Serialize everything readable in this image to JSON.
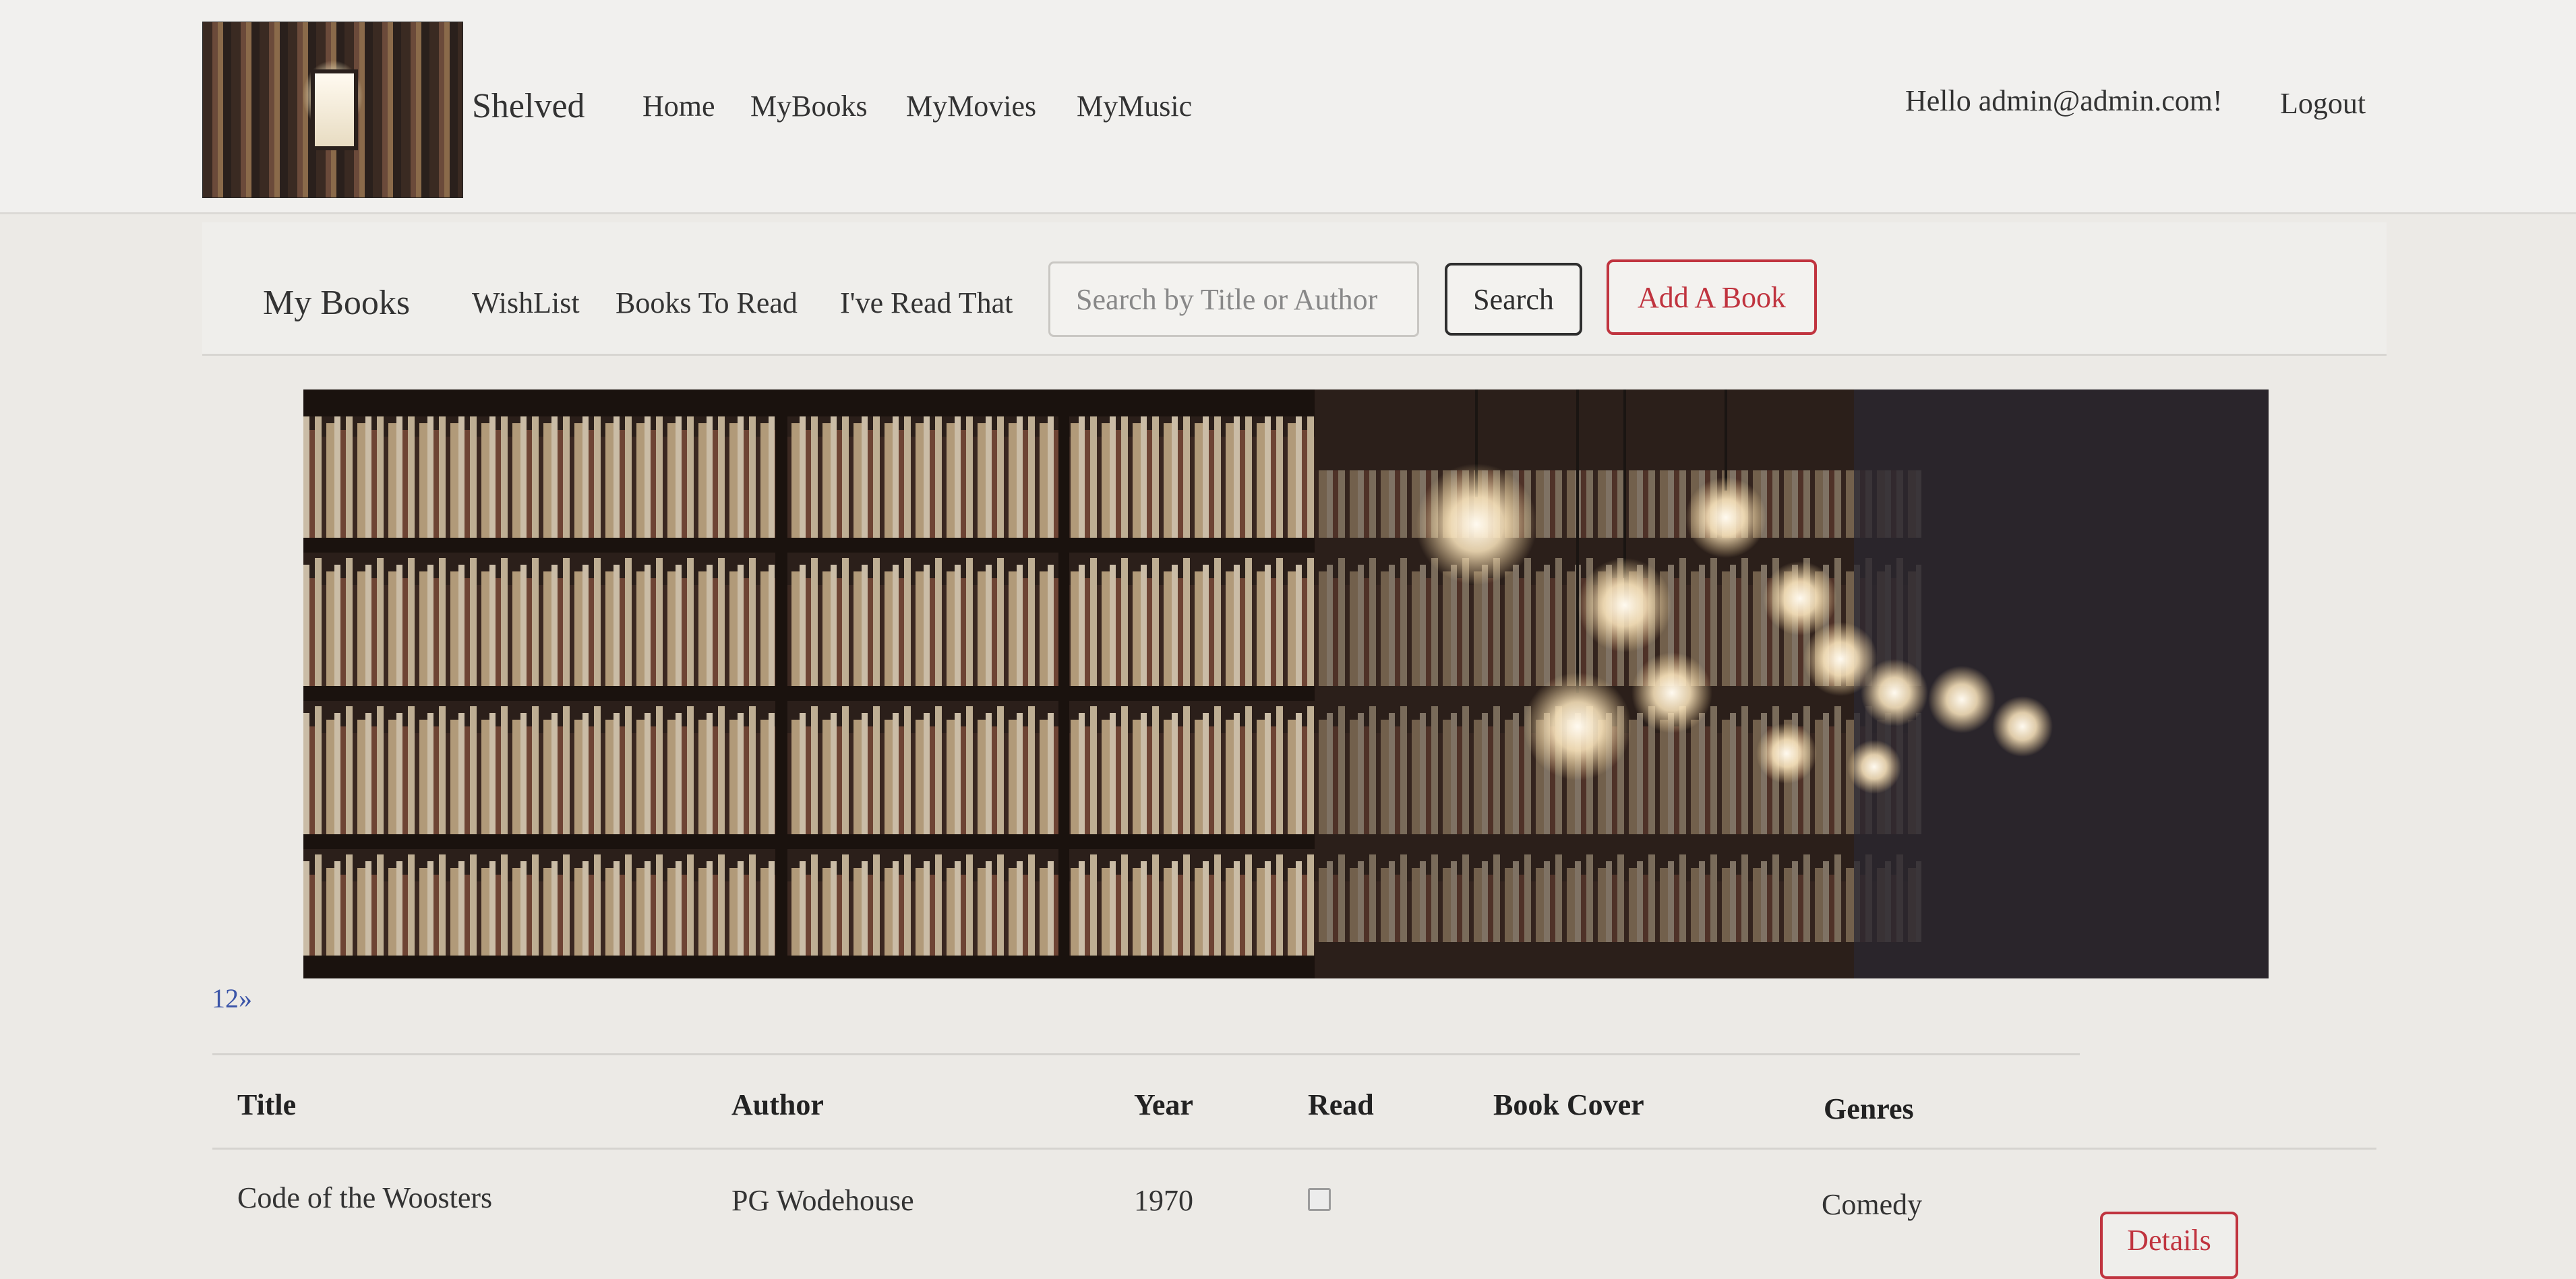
{
  "header": {
    "brand": "Shelved",
    "nav": [
      "Home",
      "MyBooks",
      "MyMovies",
      "MyMusic"
    ],
    "greeting": "Hello admin@admin.com!",
    "logout": "Logout"
  },
  "subnav": {
    "title": "My Books",
    "links": [
      "WishList",
      "Books To Read",
      "I've Read That"
    ],
    "search_placeholder": "Search by Title or Author",
    "search_button": "Search",
    "add_button": "Add A Book"
  },
  "pagination": {
    "label": "12»"
  },
  "table": {
    "columns": [
      "Title",
      "Author",
      "Year",
      "Read",
      "Book Cover",
      "Genres"
    ],
    "rows": [
      {
        "title": "Code of the Woosters",
        "author": "PG Wodehouse",
        "year": "1970",
        "read": false,
        "genres": "Comedy",
        "details": "Details"
      }
    ]
  },
  "colors": {
    "accent_red": "#c0343f",
    "link_blue": "#3b55a8",
    "background": "#eceae6"
  }
}
